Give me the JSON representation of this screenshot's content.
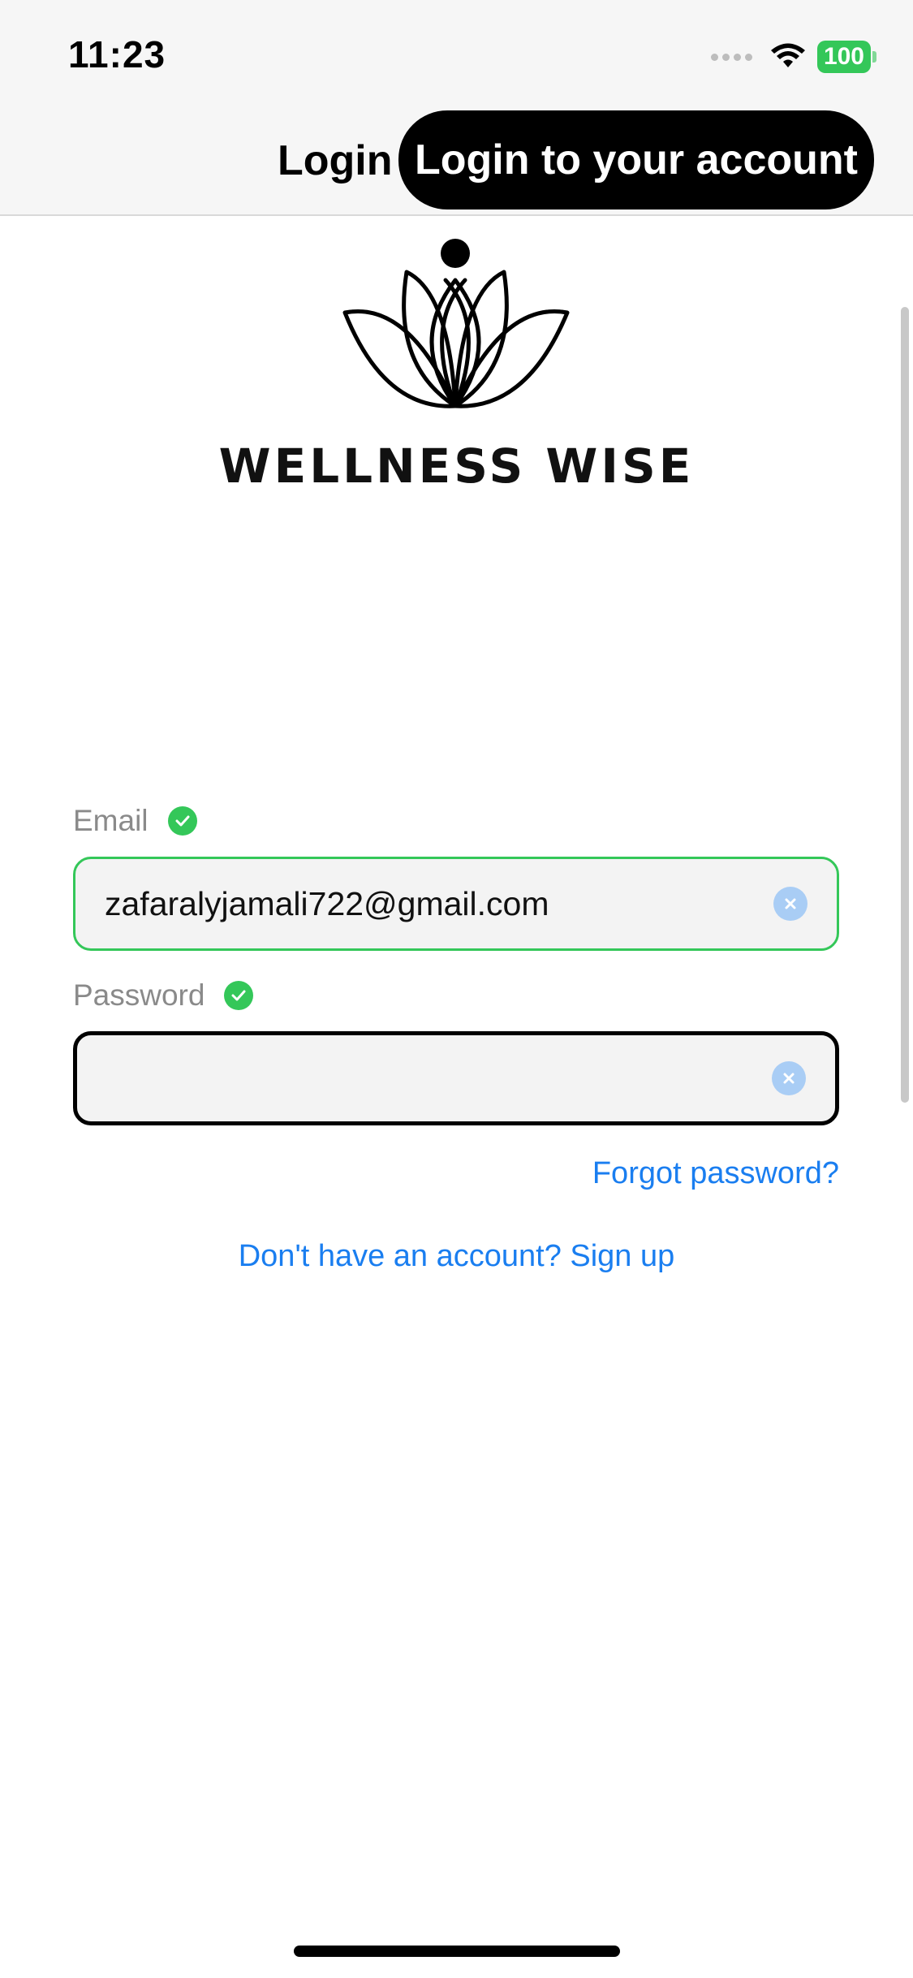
{
  "status_bar": {
    "time": "11:23",
    "battery": "100"
  },
  "nav": {
    "title": "Login",
    "action_label": "Login to your account"
  },
  "logo": {
    "name": "WELLNESS WISE"
  },
  "form": {
    "email": {
      "label": "Email",
      "value": "zafaralyjamali722@gmail.com",
      "valid": true
    },
    "password": {
      "label": "Password",
      "value": "",
      "valid": true
    },
    "forgot_link": "Forgot password?",
    "signup_link": "Don't have an account? Sign up"
  },
  "colors": {
    "accent": "#1a7ef0",
    "success": "#34c759",
    "primary": "#000000"
  }
}
